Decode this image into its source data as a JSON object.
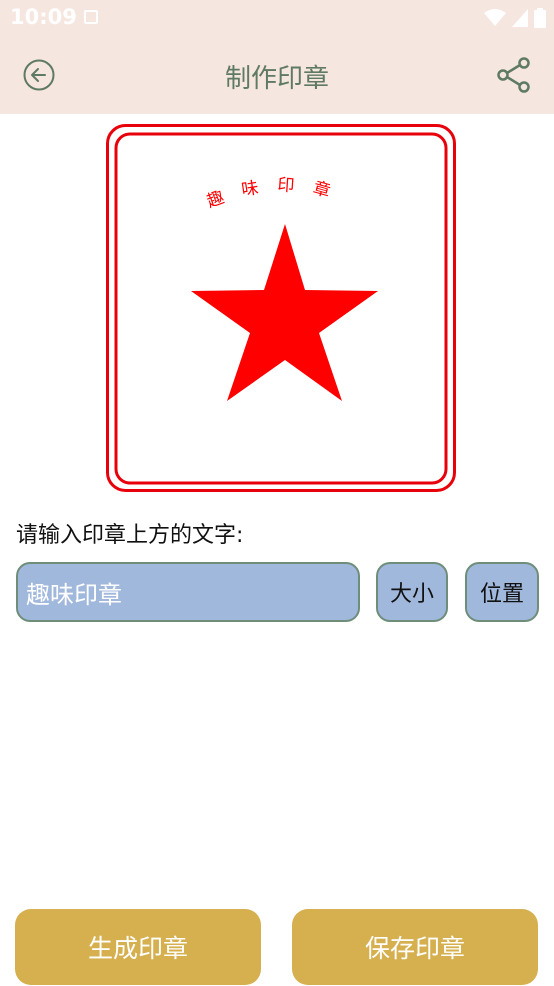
{
  "status_bar": {
    "time": "10:09",
    "icons": [
      "notification-icon",
      "wifi-icon",
      "signal-icon",
      "battery-icon"
    ]
  },
  "app_bar": {
    "title": "制作印章",
    "back_icon": "back-arrow-icon",
    "share_icon": "share-icon"
  },
  "stamp": {
    "top_text": "趣味印章",
    "color": "#ff0000",
    "border_color": "#e8000a"
  },
  "form": {
    "prompt": "请输入印章上方的文字:",
    "input_value": "趣味印章",
    "size_label": "大小",
    "position_label": "位置"
  },
  "actions": {
    "generate_label": "生成印章",
    "save_label": "保存印章"
  },
  "colors": {
    "header_bg": "#f6e6e0",
    "title_color": "#5e7a62",
    "input_bg": "#a1b8dd",
    "button_gold": "#d6b04f"
  }
}
